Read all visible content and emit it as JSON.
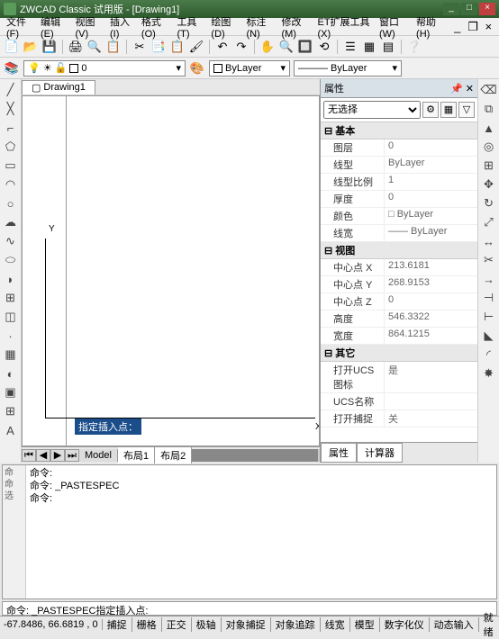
{
  "title": "ZWCAD Classic 试用版 - [Drawing1]",
  "menus": [
    "文件(F)",
    "编辑(E)",
    "视图(V)",
    "插入(I)",
    "格式(O)",
    "工具(T)",
    "绘图(D)",
    "标注(N)",
    "修改(M)",
    "ET扩展工具(X)",
    "窗口(W)",
    "帮助(H)"
  ],
  "doc_tab": "Drawing1",
  "layer": {
    "combo1_icons": "💡 ☀ 🔓",
    "combo1_text": "0",
    "combo2": "ByLayer",
    "combo3": "ByLayer"
  },
  "axis": {
    "y": "Y",
    "x": "X"
  },
  "cmd_prompt": "指定插入点：",
  "layout_tabs": [
    "Model",
    "布局1",
    "布局2"
  ],
  "properties": {
    "title": "属性",
    "selection": "无选择",
    "groups": [
      {
        "name": "基本",
        "rows": [
          {
            "k": "图层",
            "v": "0"
          },
          {
            "k": "线型",
            "v": "ByLayer"
          },
          {
            "k": "线型比例",
            "v": "1"
          },
          {
            "k": "厚度",
            "v": "0"
          },
          {
            "k": "颜色",
            "v": "□ ByLayer"
          },
          {
            "k": "线宽",
            "v": "—— ByLayer"
          }
        ]
      },
      {
        "name": "视图",
        "rows": [
          {
            "k": "中心点 X",
            "v": "213.6181"
          },
          {
            "k": "中心点 Y",
            "v": "268.9153"
          },
          {
            "k": "中心点 Z",
            "v": "0"
          },
          {
            "k": "高度",
            "v": "546.3322"
          },
          {
            "k": "宽度",
            "v": "864.1215"
          }
        ]
      },
      {
        "name": "其它",
        "rows": [
          {
            "k": "打开UCS图标",
            "v": "是"
          },
          {
            "k": "UCS名称",
            "v": ""
          },
          {
            "k": "打开捕捉",
            "v": "关"
          }
        ]
      }
    ],
    "tabs": [
      "属性",
      "计算器"
    ]
  },
  "command_history": [
    "命令:",
    "命令: _PASTESPEC",
    "命令:"
  ],
  "command_line": "命令: _PASTESPEC指定插入点:",
  "status": {
    "coords": "-67.8486, 66.6819 , 0",
    "buttons": [
      "捕捉",
      "栅格",
      "正交",
      "极轴",
      "对象捕捉",
      "对象追踪",
      "线宽",
      "模型",
      "数字化仪",
      "动态输入",
      "就绪"
    ]
  }
}
